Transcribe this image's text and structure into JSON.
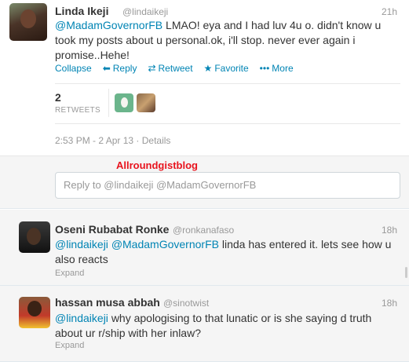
{
  "main_tweet": {
    "name": "Linda Ikeji",
    "handle": "@lindaikeji",
    "time": "21h",
    "mention": "@MadamGovernorFB",
    "text": "LMAO! eya and I had luv 4u o. didn't know u",
    "text2": "took my posts about u personal.ok, i'll stop. never ever again i",
    "text3": "promise..Hehe!",
    "actions": {
      "collapse": "Collapse",
      "reply": "Reply",
      "retweet": "Retweet",
      "favorite": "Favorite",
      "more": "More"
    },
    "retweet_count": "2",
    "retweet_label": "RETWEETS",
    "datetime": "2:53 PM - 2 Apr 13",
    "details": "Details"
  },
  "brand_label": "Allroundgistblog",
  "reply_box": {
    "placeholder": "Reply to @lindaikeji @MadamGovernorFB"
  },
  "replies": [
    {
      "name": "Oseni Rubabat Ronke",
      "handle": "@ronkanafaso",
      "time": "18h",
      "mention1": "@lindaikeji",
      "mention2": "@MadamGovernorFB",
      "text": "linda has entered it. lets see how u",
      "text2": "also reacts",
      "expand": "Expand"
    },
    {
      "name": "hassan musa abbah",
      "handle": "@sinotwist",
      "time": "18h",
      "mention1": "@lindaikeji",
      "text": "why apologising to that lunatic or is she saying d truth",
      "text2": "about ur r/ship with her inlaw?",
      "expand": "Expand"
    }
  ],
  "colors": {
    "link": "#0084b4",
    "brand": "#e8141e",
    "muted": "#999999"
  }
}
